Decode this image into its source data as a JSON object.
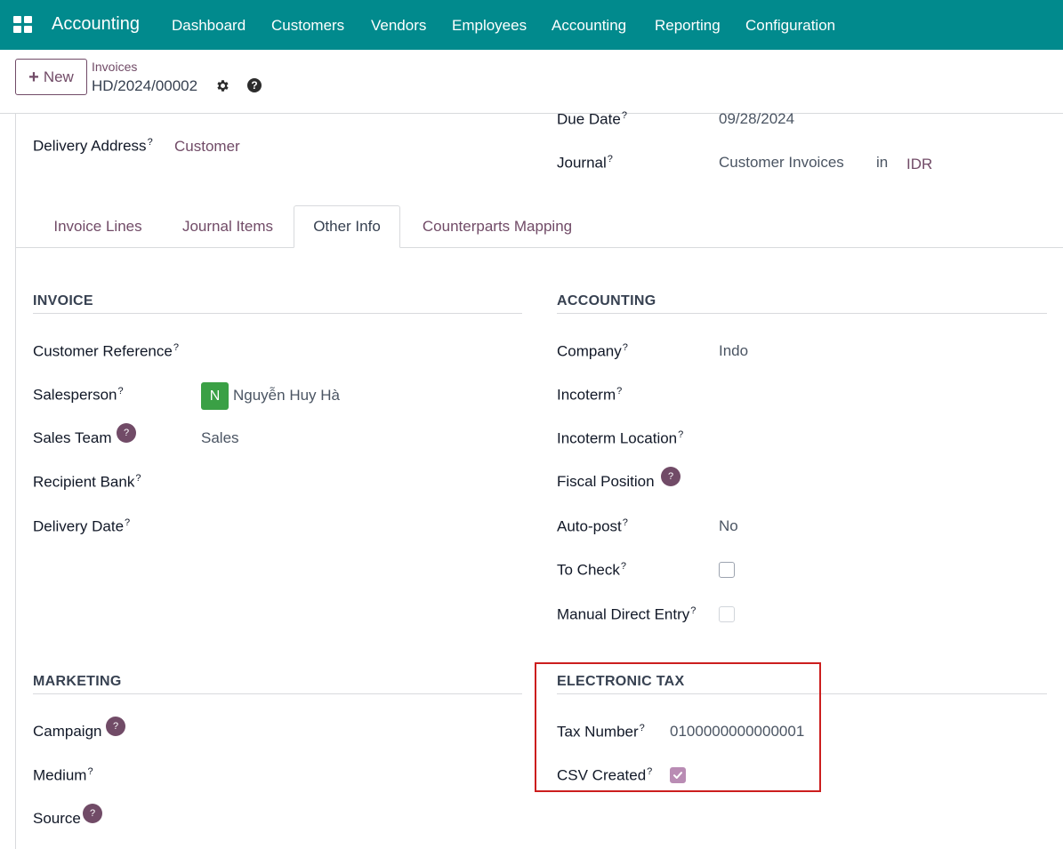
{
  "navbar": {
    "app_name": "Accounting",
    "menu": [
      "Dashboard",
      "Customers",
      "Vendors",
      "Employees",
      "Accounting",
      "Reporting",
      "Configuration"
    ]
  },
  "control_panel": {
    "new_label": "New",
    "breadcrumb": "Invoices",
    "record_name": "HD/2024/00002"
  },
  "header_fields": {
    "delivery_address_label": "Delivery Address",
    "delivery_address_value": "Customer",
    "due_date_label": "Due Date",
    "due_date_value": "09/28/2024",
    "journal_label": "Journal",
    "journal_value": "Customer Invoices",
    "journal_in": "in",
    "journal_currency": "IDR"
  },
  "tabs": [
    "Invoice Lines",
    "Journal Items",
    "Other Info",
    "Counterparts Mapping"
  ],
  "active_tab": "Other Info",
  "invoice_section": {
    "title": "INVOICE",
    "customer_reference_label": "Customer Reference",
    "salesperson_label": "Salesperson",
    "salesperson_initial": "N",
    "salesperson_value": "Nguyễn Huy Hà",
    "sales_team_label": "Sales Team",
    "sales_team_value": "Sales",
    "recipient_bank_label": "Recipient Bank",
    "delivery_date_label": "Delivery Date"
  },
  "accounting_section": {
    "title": "ACCOUNTING",
    "company_label": "Company",
    "company_value": "Indo",
    "incoterm_label": "Incoterm",
    "incoterm_location_label": "Incoterm Location",
    "fiscal_position_label": "Fiscal Position",
    "auto_post_label": "Auto-post",
    "auto_post_value": "No",
    "to_check_label": "To Check",
    "to_check_checked": false,
    "manual_direct_entry_label": "Manual Direct Entry",
    "manual_direct_entry_checked": false
  },
  "marketing_section": {
    "title": "MARKETING",
    "campaign_label": "Campaign",
    "medium_label": "Medium",
    "source_label": "Source"
  },
  "electronic_tax_section": {
    "title": "ELECTRONIC TAX",
    "tax_number_label": "Tax Number",
    "tax_number_value": "0100000000000001",
    "csv_created_label": "CSV Created",
    "csv_created_checked": true
  },
  "help_marker": "?",
  "colors": {
    "navbar": "#018a8d",
    "brand": "#714b67",
    "avatar": "#3aa045",
    "highlight": "#cc1e1e"
  }
}
